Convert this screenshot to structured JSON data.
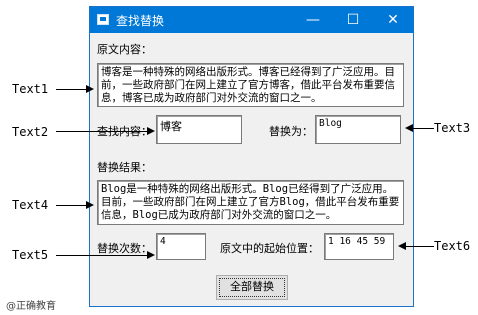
{
  "window": {
    "title": "查找替换",
    "min": "—",
    "max": "☐",
    "close": "✕"
  },
  "labels": {
    "original": "原文内容：",
    "find": "查找内容：",
    "replace": "替换为：",
    "result": "替换结果：",
    "count": "替换次数：",
    "positions": "原文中的起始位置："
  },
  "fields": {
    "text1": "博客是一种特殊的网络出版形式。博客已经得到了广泛应用。目前，一些政府部门在网上建立了官方博客，借此平台发布重要信息，博客已成为政府部门对外交流的窗口之一。",
    "text2": "博客",
    "text3": "Blog",
    "text4": "Blog是一种特殊的网络出版形式。Blog已经得到了广泛应用。目前，一些政府部门在网上建立了官方Blog，借此平台发布重要信息，Blog已成为政府部门对外交流的窗口之一。",
    "text5": "4",
    "text6": "1 16 45 59"
  },
  "button": {
    "replace_all": "全部替换"
  },
  "callouts": {
    "text1": "Text1",
    "text2": "Text2",
    "text3": "Text3",
    "text4": "Text4",
    "text5": "Text5",
    "text6": "Text6"
  },
  "watermark": "@正确教育"
}
